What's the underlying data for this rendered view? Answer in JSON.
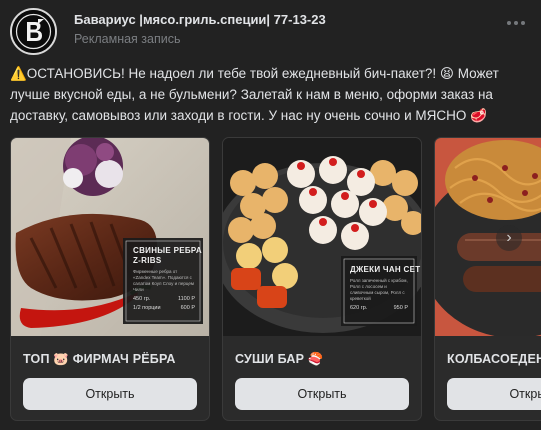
{
  "post": {
    "author": "Бавариус |мясо.гриль.специи| 77-13-23",
    "subtitle": "Рекламная запись",
    "text_line1": "⚠️ОСТАНОВИСЬ! Не надоел ли тебе твой ежедневный бич-пакет?! 😫 Может",
    "text_line2": "лучше вкусной еды, а не бульмени? Залетай к нам в меню, оформи заказ на",
    "text_line3": "доставку, самовывоз или заходи в гости. У нас ну очень сочно и МЯСНО 🥩"
  },
  "cards": [
    {
      "title": "ТОП 🐷 ФИРМАЧ РЁБРА",
      "button": "Открыть",
      "board": {
        "name1": "СВИНЫЕ РЕБРА",
        "name2": "Z-RIBS",
        "desc": "Фирменные ребра от «Zandex Team». Подаются с салатом Коул Слоу и перцем Чили",
        "row1_left": "450 гр.",
        "row1_right": "1100 Р",
        "row2_left": "1/2 порции",
        "row2_right": "600 Р"
      }
    },
    {
      "title": "СУШИ БАР 🍣",
      "button": "Открыть",
      "board": {
        "name1": "ДЖЕКИ ЧАН СЕТ",
        "desc": "Ролл запеченный с крабом, Ролл с лососем и сливочным сыром, Ролл с креветкой",
        "row1_left": "620 гр.",
        "row1_right": "950 Р"
      }
    },
    {
      "title": "КОЛБАСОЕДЕН",
      "button": "Открыть"
    }
  ],
  "colors": {
    "background": "#222222",
    "card": "#2b2b2b",
    "button": "#e1e3e6",
    "muted": "#7b7e82"
  }
}
